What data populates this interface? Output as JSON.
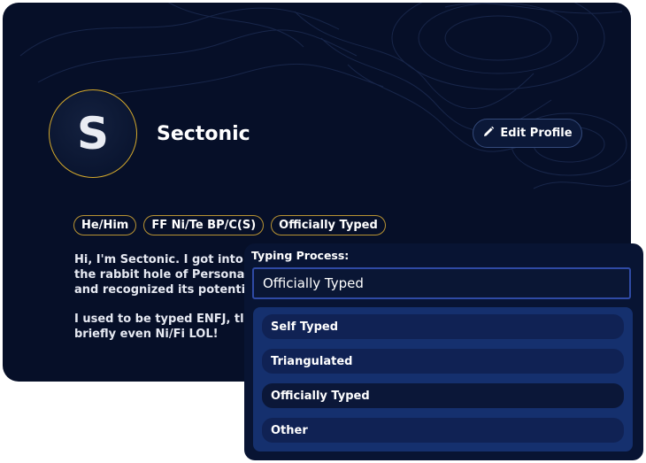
{
  "profile": {
    "avatar_letter": "S",
    "name": "Sectonic",
    "edit_label": "Edit Profile",
    "tags": [
      "He/Him",
      "FF Ni/Te BP/C(S)",
      "Officially Typed"
    ],
    "bio_lines": [
      "Hi, I'm Sectonic. I got into",
      "the rabbit hole of Personal",
      "and recognized its potenti"
    ],
    "bio_lines_2": [
      "I used to be typed ENFJ, tl",
      "briefly even Ni/Fi LOL!"
    ]
  },
  "typing_process": {
    "label": "Typing Process:",
    "selected_value": "Officially Typed",
    "options": [
      "Self Typed",
      "Triangulated",
      "Officially Typed",
      "Other"
    ],
    "selected_index": 2
  },
  "colors": {
    "card_bg": "#060f28",
    "accent_gold": "#d4a92c",
    "select_border": "#2f4aa5",
    "option_bg": "#102254"
  },
  "icons": {
    "edit": "pencil-icon"
  }
}
